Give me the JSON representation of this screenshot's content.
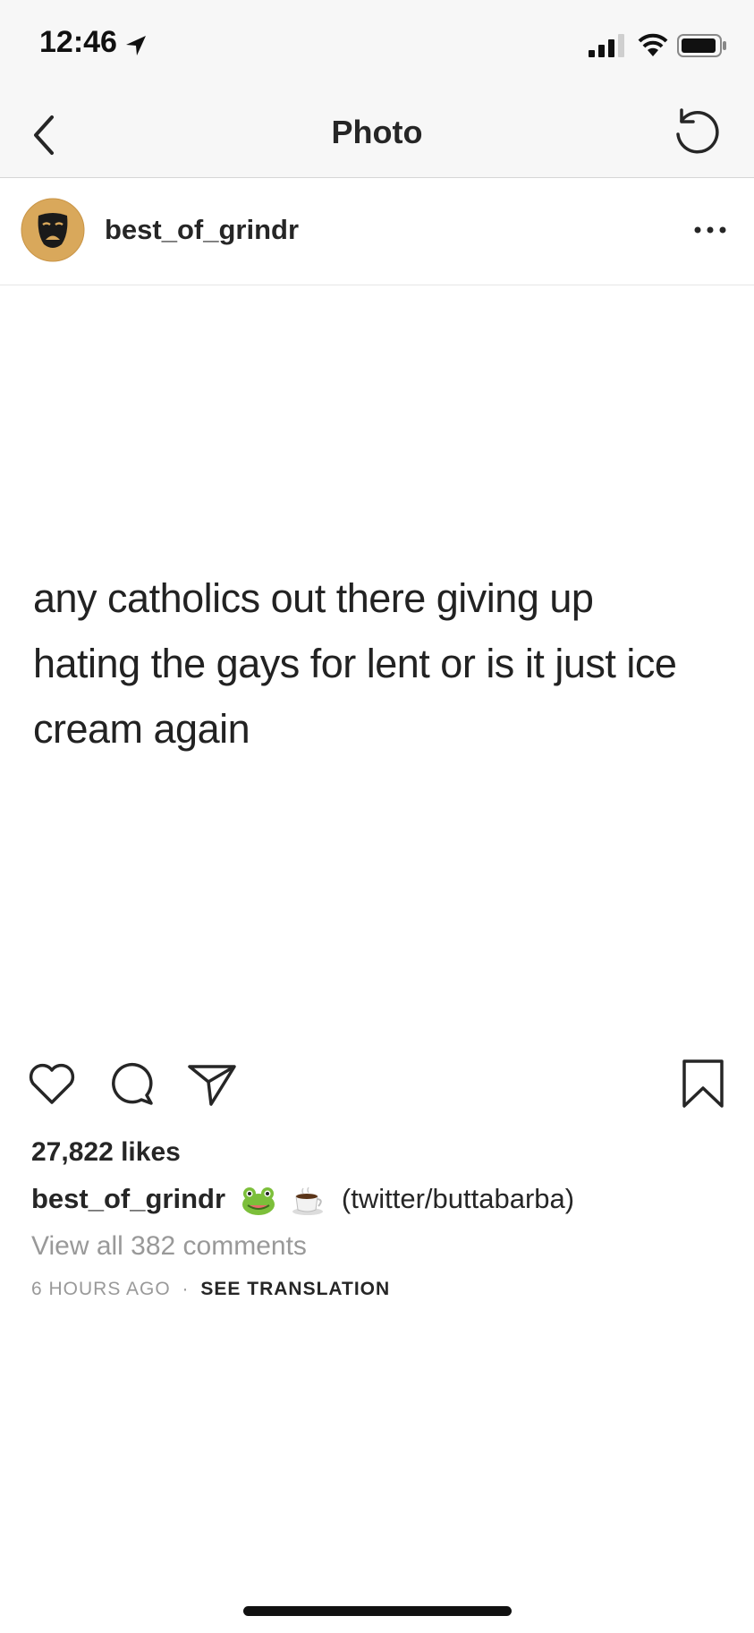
{
  "status_bar": {
    "time": "12:46"
  },
  "nav": {
    "title": "Photo"
  },
  "post": {
    "username": "best_of_grindr",
    "text_lines": [
      "any catholics out there giving up",
      "hating the gays for lent or is it just ice",
      "cream again"
    ],
    "likes": "27,822 likes",
    "caption_user": "best_of_grindr",
    "caption_emojis": [
      "frog-emoji",
      "coffee-emoji"
    ],
    "caption_text": "(twitter/buttabarba)",
    "view_comments": "View all 382 comments",
    "time_ago": "6 HOURS AGO",
    "separator": "·",
    "see_translation": "SEE TRANSLATION"
  },
  "icons": {
    "back": "chevron-left-icon",
    "refresh": "refresh-icon",
    "more": "more-horizontal-icon",
    "like": "heart-icon",
    "comment": "comment-icon",
    "share": "send-icon",
    "save": "bookmark-icon"
  },
  "colors": {
    "text": "#262626",
    "secondary": "#999999",
    "bar_bg": "#f7f7f7"
  }
}
